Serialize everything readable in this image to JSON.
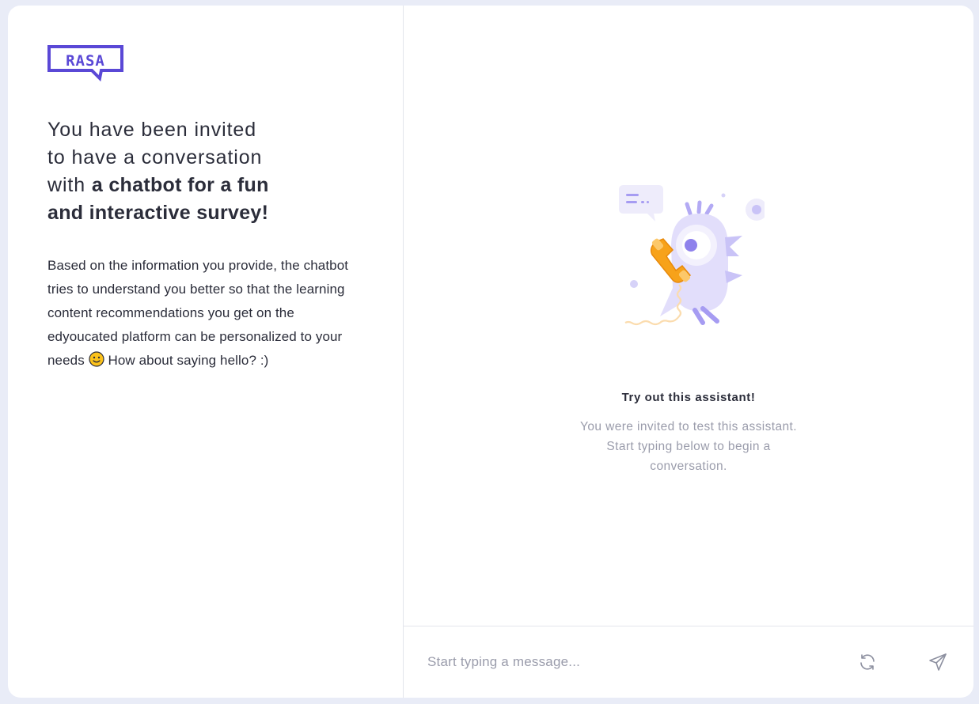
{
  "brand": {
    "logo_text": "RASA",
    "logo_color": "#5a48d6"
  },
  "intro": {
    "heading_line1": "You have been invited",
    "heading_line2": "to have a conversation",
    "heading_line3_regular": "with ",
    "heading_line3_bold": "a chatbot for a fun",
    "heading_line4_bold": "and interactive survey!",
    "description_before_emoji": "Based on the information you provide, the chatbot tries to understand you better so that the learning content recommendations you get on the edyoucated platform can be personalized to your needs ",
    "emoji": "slightly-smiling-face",
    "description_after_emoji": " How about saying hello? :)"
  },
  "chat": {
    "illustration": "bird-with-phone-illustration",
    "empty_title": "Try out this assistant!",
    "empty_text": "You were invited to test this assistant. Start typing below to begin a conversation."
  },
  "composer": {
    "placeholder": "Start typing a message...",
    "reset_icon": "refresh-icon",
    "send_icon": "send-icon"
  },
  "colors": {
    "background": "#e9ecf7",
    "accent_purple": "#c9c3f7",
    "phone_orange": "#f7a21a",
    "muted_text": "#9a9cab"
  }
}
